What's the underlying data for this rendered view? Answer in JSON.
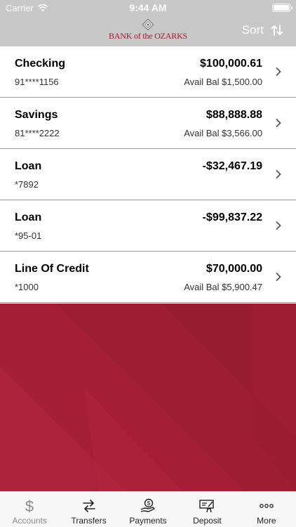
{
  "status_bar": {
    "carrier": "Carrier",
    "time": "9:44 AM"
  },
  "header": {
    "logo_text": "BANK of the OZARKS",
    "sort_label": "Sort"
  },
  "accounts": [
    {
      "name": "Checking",
      "number": "91****1156",
      "balance": "$100,000.61",
      "avail": "Avail Bal $1,500.00"
    },
    {
      "name": "Savings",
      "number": "81****2222",
      "balance": "$88,888.88",
      "avail": "Avail Bal $3,566.00"
    },
    {
      "name": "Loan",
      "number": "*7892",
      "balance": "-$32,467.19",
      "avail": ""
    },
    {
      "name": "Loan",
      "number": "*95-01",
      "balance": "-$99,837.22",
      "avail": ""
    },
    {
      "name": "Line Of Credit",
      "number": "*1000",
      "balance": "$70,000.00",
      "avail": "Avail Bal $5,900.47"
    }
  ],
  "tabs": [
    {
      "label": "Accounts",
      "icon": "dollar-icon",
      "active": true
    },
    {
      "label": "Transfers",
      "icon": "transfer-arrows-icon",
      "active": false
    },
    {
      "label": "Payments",
      "icon": "hand-payment-icon",
      "active": false
    },
    {
      "label": "Deposit",
      "icon": "check-deposit-icon",
      "active": false
    },
    {
      "label": "More",
      "icon": "more-dots-icon",
      "active": false
    }
  ],
  "colors": {
    "brand": "#a41f35",
    "header": "#c8c8c8"
  }
}
